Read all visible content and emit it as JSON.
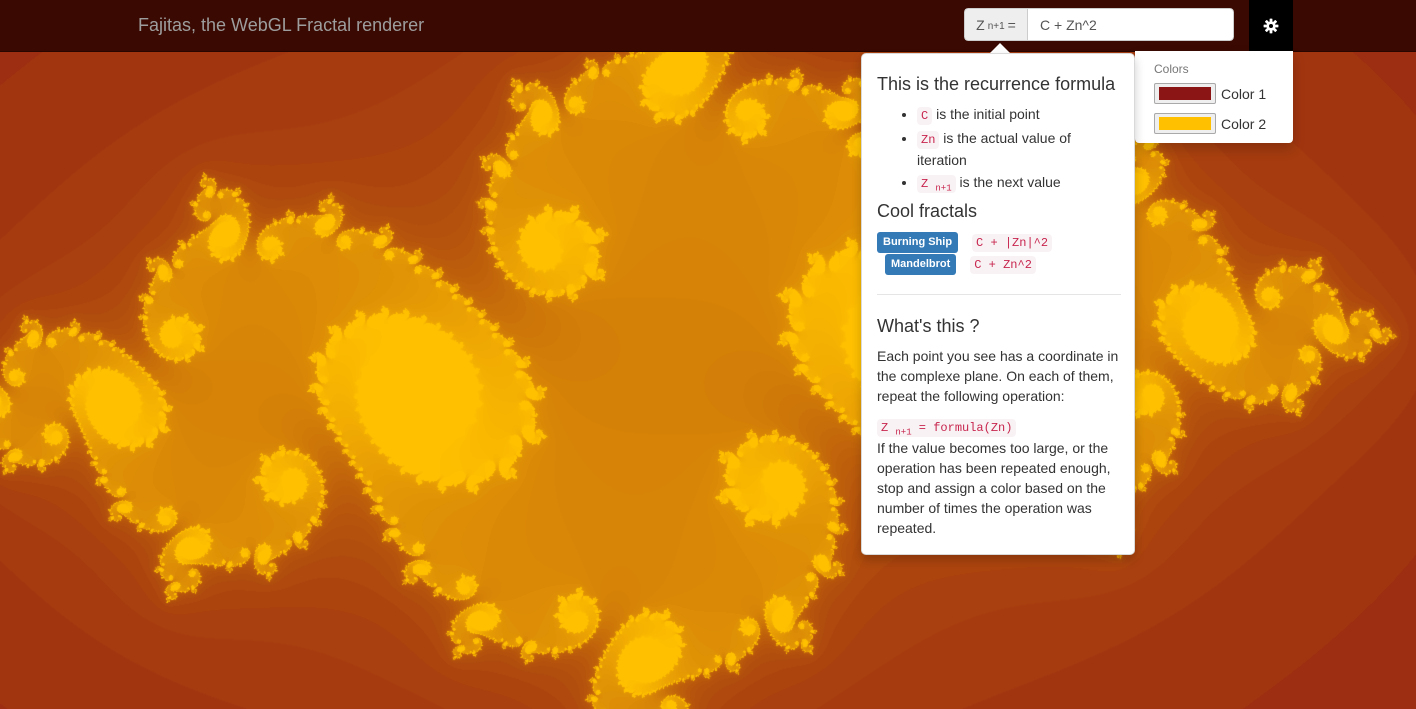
{
  "navbar": {
    "brand": "Fajitas, the WebGL Fractal renderer",
    "formula_addon_z": "Z",
    "formula_addon_sub": "n+1",
    "formula_addon_eq": "=",
    "formula_value": "C + Zn^2"
  },
  "colors": {
    "header": "Colors",
    "items": [
      {
        "label": "Color 1",
        "value": "#8b1414"
      },
      {
        "label": "Color 2",
        "value": "#ffc000"
      }
    ]
  },
  "help": {
    "recurrence_title": "This is the recurrence formula",
    "bullets": [
      {
        "code": "C",
        "text": "is the initial point"
      },
      {
        "code": "Zn",
        "text": "is the actual value of iteration"
      },
      {
        "code_z": "Z",
        "code_sub": "n+1",
        "text": "is the next value"
      }
    ],
    "cool_title": "Cool fractals",
    "fractals": [
      {
        "name": "Burning Ship",
        "formula": "C + |Zn|^2"
      },
      {
        "name": "Mandelbrot",
        "formula": "C + Zn^2"
      }
    ],
    "whats_title": "What's this ?",
    "para1": "Each point you see has a coordinate in the complexe plane. On each of them, repeat the following operation:",
    "op_z": "Z",
    "op_sub": "n+1",
    "op_rest": " = formula(Zn)",
    "para2": "If the value becomes too large, or the operation has been repeated enough, stop and assign a color based on the number of times the operation was repeated."
  },
  "icons": {
    "settings": "gear-icon"
  },
  "theme": {
    "navbar": "#3a0a02",
    "badge": "#337ab7",
    "code": "#c7254e"
  }
}
